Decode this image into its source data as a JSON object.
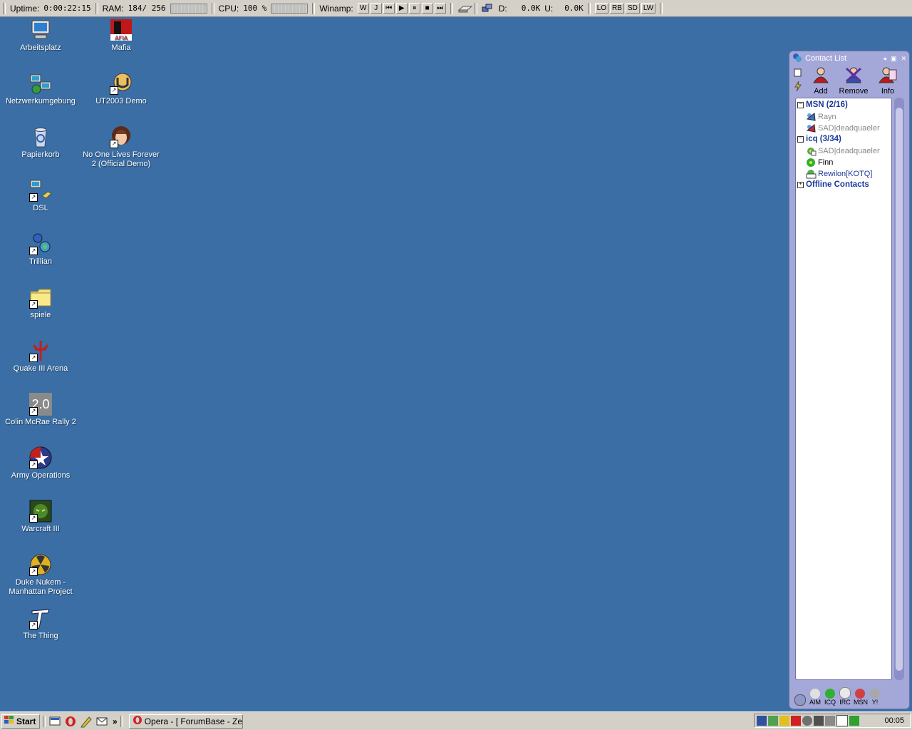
{
  "topbar": {
    "uptime_label": "Uptime:",
    "uptime_value": "0:00:22:15",
    "ram_label": "RAM:",
    "ram_value": "184/ 256",
    "cpu_label": "CPU:",
    "cpu_value": "100 %",
    "winamp_label": "Winamp:",
    "winamp_buttons": [
      "W",
      "J",
      "⏮",
      "▶",
      "⏸",
      "■",
      "⏭"
    ],
    "drive_label": "D:",
    "down_value": "0.0K",
    "up_label": "U:",
    "up_value": "0.0K",
    "shortcut_buttons": [
      "LO",
      "RB",
      "SD",
      "LW"
    ]
  },
  "desktop": {
    "icons": [
      {
        "label": "Arbeitsplatz",
        "icon": "my-computer-icon"
      },
      {
        "label": "Netzwerkumgebung",
        "icon": "network-icon"
      },
      {
        "label": "Papierkorb",
        "icon": "recycle-bin-icon"
      },
      {
        "label": "DSL",
        "icon": "dsl-icon"
      },
      {
        "label": "Trillian",
        "icon": "trillian-icon"
      },
      {
        "label": "spiele",
        "icon": "folder-icon"
      },
      {
        "label": "Quake III Arena",
        "icon": "quake-icon"
      },
      {
        "label": "Colin McRae Rally 2",
        "icon": "rally-icon",
        "badge": "2.0"
      },
      {
        "label": "Army Operations",
        "icon": "army-icon"
      },
      {
        "label": "Warcraft III",
        "icon": "warcraft-icon"
      },
      {
        "label": "Duke Nukem - Manhattan Project",
        "icon": "duke-icon"
      },
      {
        "label": "The Thing",
        "icon": "thing-icon"
      },
      {
        "label": "Mafia",
        "icon": "mafia-icon"
      },
      {
        "label": "UT2003 Demo",
        "icon": "ut-icon"
      },
      {
        "label": "No One Lives Forever 2 (Official Demo)",
        "icon": "nolf-icon"
      }
    ]
  },
  "contact_list": {
    "title": "Contact List",
    "toolbar": {
      "add": "Add",
      "remove": "Remove",
      "info": "Info"
    },
    "groups": [
      {
        "name": "MSN (2/16)",
        "contacts": [
          {
            "name": "Rayn",
            "status": "away"
          },
          {
            "name": "SAD|deadquaeler",
            "status": "online"
          }
        ]
      },
      {
        "name": "icq (3/34)",
        "contacts": [
          {
            "name": "SAD|deadquaeler",
            "status": "away"
          },
          {
            "name": "Finn",
            "status": "online"
          },
          {
            "name": "Rewilon[KOTQ]",
            "status": "na"
          }
        ]
      },
      {
        "name": "Offline Contacts",
        "contacts": []
      }
    ],
    "mediums": [
      "AIM",
      "ICQ",
      "IRC",
      "MSN",
      "Y!"
    ]
  },
  "taskbar": {
    "start_label": "Start",
    "quicklaunch_more": "»",
    "task_opera": "Opera - [ ForumBase - Zei...",
    "clock": "00:05"
  },
  "colors": {
    "desktop": "#3a6ea5",
    "panel": "#d4d0c8",
    "trillian_frame": "#a4a8d8",
    "group_text": "#1a3a9a"
  }
}
